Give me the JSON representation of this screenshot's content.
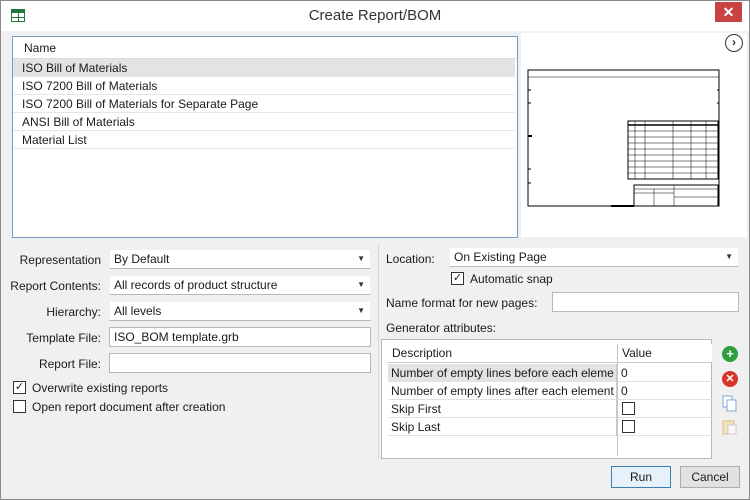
{
  "window": {
    "title": "Create Report/BOM"
  },
  "report_list": {
    "header": "Name",
    "items": [
      "ISO Bill of Materials",
      "ISO 7200 Bill of Materials",
      "ISO 7200 Bill of Materials for Separate Page",
      "ANSI Bill of Materials",
      "Material List"
    ],
    "selected_index": 0
  },
  "preview": {
    "nav_icon": "chevron-right-circle-icon"
  },
  "form": {
    "representation": {
      "label": "Representation",
      "value": "By Default"
    },
    "report_contents": {
      "label": "Report Contents:",
      "value": "All records of product structure"
    },
    "hierarchy": {
      "label": "Hierarchy:",
      "value": "All levels"
    },
    "template_file": {
      "label": "Template File:",
      "value": "ISO_BOM template.grb"
    },
    "report_file": {
      "label": "Report File:",
      "value": ""
    },
    "overwrite": {
      "label": "Overwrite existing reports",
      "checked": true
    },
    "open_after": {
      "label": "Open report document after creation",
      "checked": false
    }
  },
  "location": {
    "label": "Location:",
    "value": "On Existing Page",
    "automatic_snap": {
      "label": "Automatic snap",
      "checked": true
    },
    "name_format_label": "Name format for new pages:",
    "name_format_value": ""
  },
  "generator": {
    "label": "Generator attributes:",
    "columns": [
      "Description",
      "Value"
    ],
    "rows": [
      {
        "description": "Number of empty lines before each eleme",
        "value": "0",
        "type": "text"
      },
      {
        "description": "Number of empty lines after each element",
        "value": "0",
        "type": "text"
      },
      {
        "description": "Skip First",
        "value": "",
        "type": "checkbox"
      },
      {
        "description": "Skip Last",
        "value": "",
        "type": "checkbox"
      }
    ]
  },
  "actions": {
    "run": "Run",
    "cancel": "Cancel"
  },
  "colors": {
    "add": "#2e9e3e",
    "remove": "#d9342b",
    "selection": "#e3e3e3",
    "close": "#c74343"
  }
}
